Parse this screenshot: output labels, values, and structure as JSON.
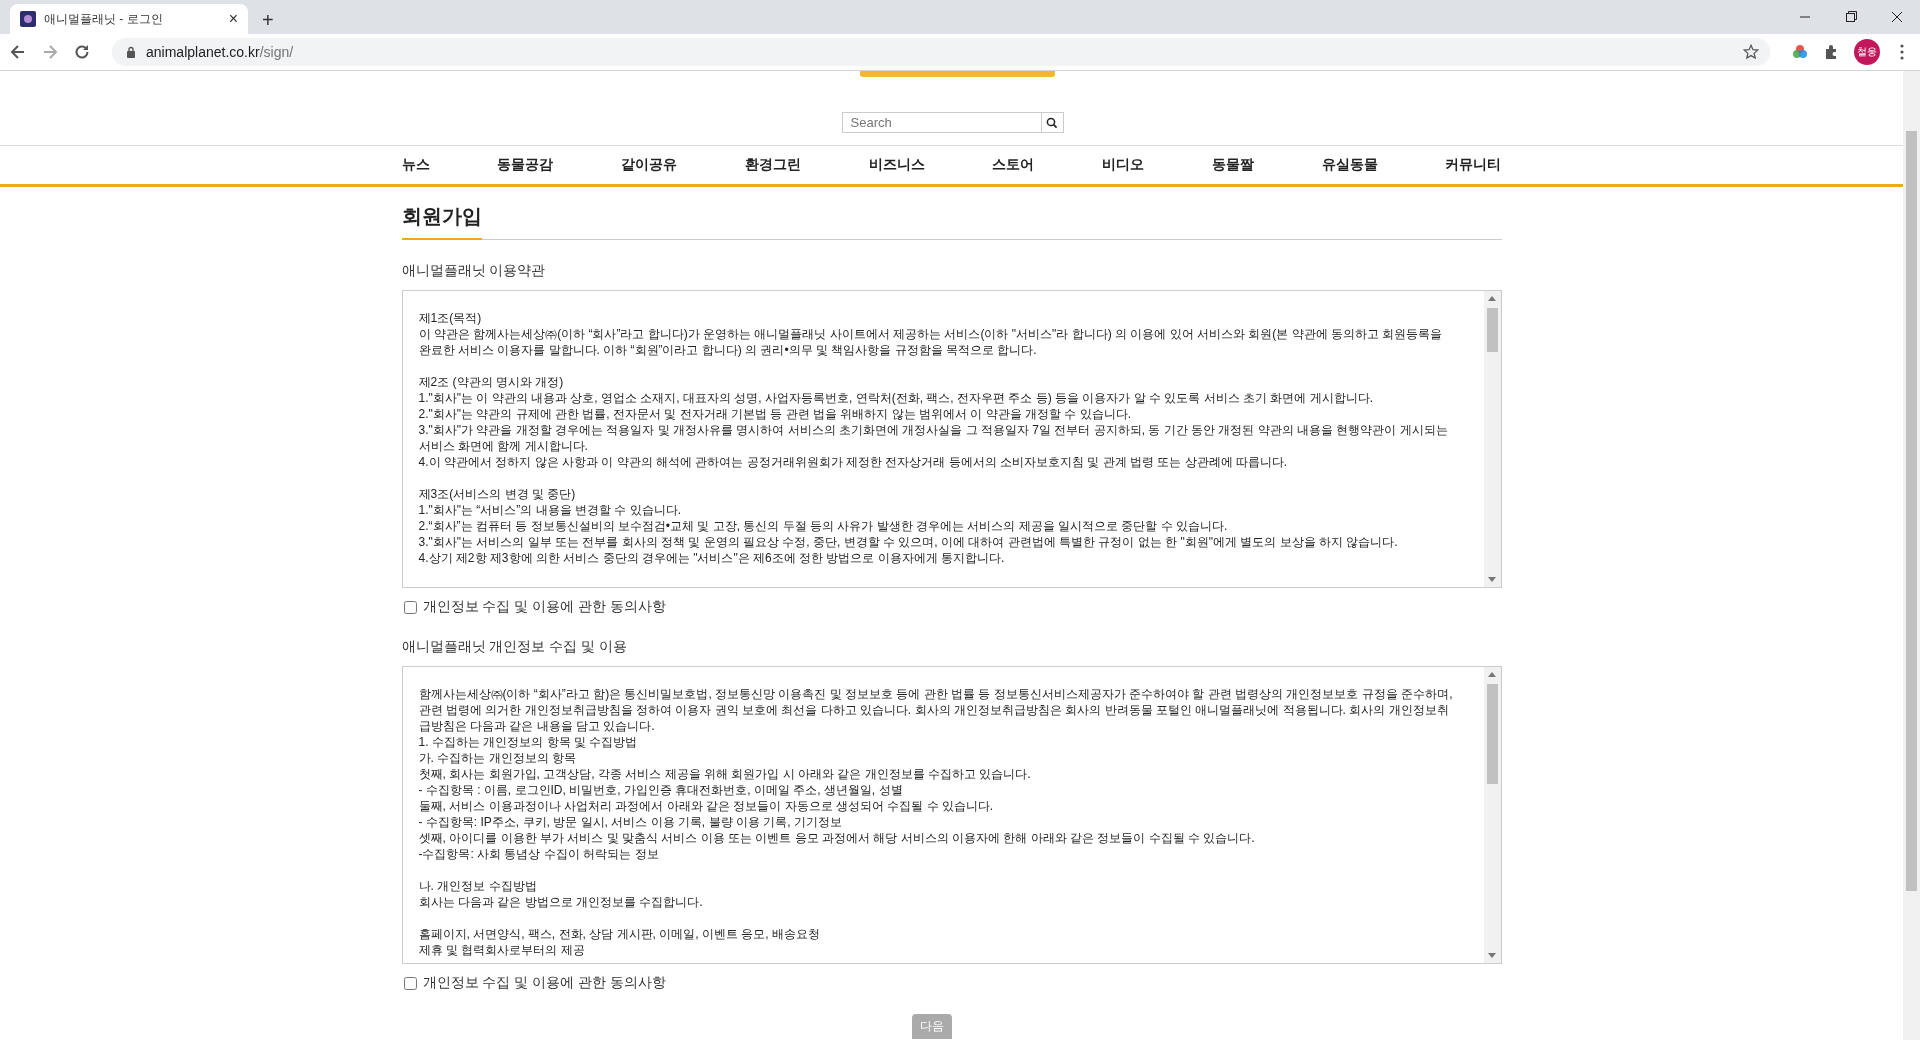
{
  "browser": {
    "tab": {
      "title": "애니멀플래닛 - 로그인",
      "close": "×"
    },
    "new_tab": "+",
    "url_host": "animalplanet.co.kr",
    "url_path": "/sign/",
    "profile": "철웅"
  },
  "search": {
    "placeholder": "Search"
  },
  "nav": [
    {
      "label": "뉴스"
    },
    {
      "label": "동물공감"
    },
    {
      "label": "같이공유"
    },
    {
      "label": "환경그린"
    },
    {
      "label": "비즈니스"
    },
    {
      "label": "스토어"
    },
    {
      "label": "비디오"
    },
    {
      "label": "동물짤"
    },
    {
      "label": "유실동물"
    },
    {
      "label": "커뮤니티"
    }
  ],
  "page_title": "회원가입",
  "sections": [
    {
      "heading": "애니멀플래닛 이용약관",
      "paragraphs": [
        [
          "제1조(목적)",
          "이 약관은 함께사는세상㈜(이하 “회사”라고 합니다)가 운영하는 애니멀플래닛 사이트에서 제공하는 서비스(이하 \"서비스\"라 합니다) 의 이용에 있어 서비스와 회원(본 약관에 동의하고 회원등록을",
          "완료한 서비스 이용자를 말합니다. 이하 “회원”이라고 합니다) 의 권리•의무 및 책임사항을 규정함을 목적으로 합니다."
        ],
        [
          "제2조 (약관의 명시와 개정)",
          "1.\"회사\"는 이 약관의 내용과 상호, 영업소 소재지, 대표자의 성명, 사업자등록번호, 연락처(전화, 팩스, 전자우편 주소 등) 등을 이용자가 알 수 있도록 서비스 초기 화면에 게시합니다.",
          "2.\"회사\"는 약관의 규제에 관한 법률, 전자문서 및 전자거래 기본법 등 관련 법을 위배하지 않는 범위에서 이 약관을 개정할 수 있습니다.",
          "3.\"회사\"가 약관을 개정할 경우에는 적용일자 및 개정사유를 명시하여 서비스의 초기화면에 개정사실을 그 적용일자 7일 전부터 공지하되, 동 기간 동안 개정된 약관의 내용을 현행약관이 게시되는",
          "서비스 화면에 함께 게시합니다.",
          "4.이 약관에서 정하지 않은 사항과 이 약관의 해석에 관하여는 공정거래위원회가 제정한 전자상거래 등에서의 소비자보호지침 및 관계 법령 또는 상관례에 따릅니다."
        ],
        [
          "제3조(서비스의 변경 및 중단)",
          "1.\"회사\"는 “서비스”의 내용을 변경할 수 있습니다.",
          "2.“회사”는 컴퓨터 등 정보통신설비의 보수점검•교체 및 고장, 통신의 두절 등의 사유가 발생한 경우에는 서비스의 제공을 일시적으로 중단할 수 있습니다.",
          "3.\"회사\"는 서비스의 일부 또는 전부를 회사의 정책 및 운영의 필요상 수정, 중단, 변경할 수 있으며, 이에 대하여 관련법에 특별한 규정이 없는 한 \"회원\"에게 별도의 보상을 하지 않습니다.",
          "4.상기 제2항 제3항에 의한 서비스 중단의 경우에는 \"서비스\"은 제6조에 정한 방법으로 이용자에게 통지합니다."
        ]
      ],
      "agree": {
        "label": "개인정보 수집 및 이용에 관한 동의사항",
        "checked": false
      }
    },
    {
      "heading": "애니멀플래닛 개인정보 수집 및 이용",
      "paragraphs": [
        [
          "함께사는세상㈜(이하 “회사”라고 함)은 통신비밀보호법, 정보통신망 이용촉진 및 정보보호 등에 관한 법률 등 정보통신서비스제공자가 준수하여야 할 관련 법령상의 개인정보보호 규정을 준수하며,",
          "관련 법령에 의거한 개인정보취급방침을 정하여 이용자 권익 보호에 최선을 다하고 있습니다. 회사의 개인정보취급방침은 회사의 반려동물 포털인 애니멀플래닛에 적용됩니다. 회사의 개인정보취",
          "급방침은 다음과 같은 내용을 담고 있습니다.",
          "1. 수집하는 개인정보의 항목 및 수집방법",
          "가. 수집하는 개인정보의 항목",
          "첫째, 회사는 회원가입, 고객상담, 각종 서비스 제공을 위해 회원가입 시 아래와 같은 개인정보를 수집하고 있습니다.",
          "- 수집항목 : 이름, 로그인ID, 비밀번호, 가입인증 휴대전화번호, 이메일 주소, 생년월일, 성별",
          "둘째, 서비스 이용과정이나 사업처리 과정에서 아래와 같은 정보들이 자동으로 생성되어 수집될 수 있습니다.",
          "- 수집항목: IP주소, 쿠키, 방문 일시, 서비스 이용 기록, 불량 이용 기록, 기기정보",
          "셋째, 아이디를 이용한 부가 서비스 및 맞춤식 서비스 이용 또는 이벤트 응모 과정에서 해당 서비스의 이용자에 한해 아래와 같은 정보들이 수집될 수 있습니다.",
          "-수집항목: 사회 통념상 수집이 허락되는 정보"
        ],
        [
          "나. 개인정보 수집방법",
          "회사는 다음과 같은 방법으로 개인정보를 수집합니다."
        ],
        [
          "홈페이지, 서면양식, 팩스, 전화, 상담 게시판, 이메일, 이벤트 응모, 배송요청",
          "제휴 및 협력회사로부터의 제공"
        ]
      ],
      "agree": {
        "label": "개인정보 수집 및 이용에 관한 동의사항",
        "checked": false
      }
    }
  ],
  "next_button": {
    "label": "다음",
    "disabled": true
  }
}
